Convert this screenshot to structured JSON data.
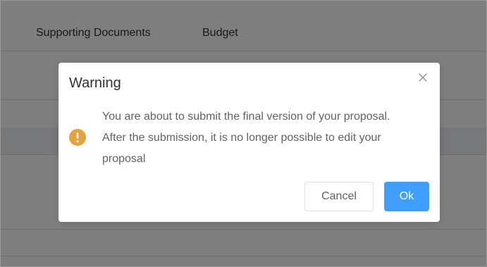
{
  "tabs": [
    {
      "label": "Supporting Documents"
    },
    {
      "label": "Budget"
    }
  ],
  "dialog": {
    "title": "Warning",
    "close_icon": "close-icon",
    "status_icon": "warning-icon",
    "message_line_1": "You are about to submit the final version of your proposal.",
    "message_line_2": "After the submission, it is no longer possible to edit your",
    "message_line_3": "proposal",
    "cancel_label": "Cancel",
    "ok_label": "Ok"
  },
  "colors": {
    "primary": "#409eff",
    "warning": "#e6a23c",
    "overlay": "rgba(0,0,0,0.5)"
  }
}
